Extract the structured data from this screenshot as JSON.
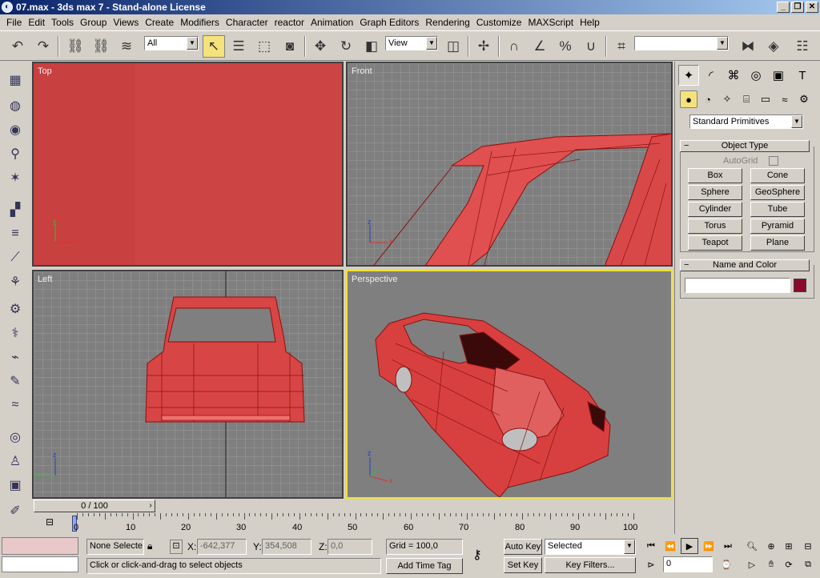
{
  "title": "07.max - 3ds max 7 - Stand-alone License",
  "window_buttons": [
    "_",
    "❐",
    "✕"
  ],
  "menu": [
    "File",
    "Edit",
    "Tools",
    "Group",
    "Views",
    "Create",
    "Modifiers",
    "Character",
    "reactor",
    "Animation",
    "Graph Editors",
    "Rendering",
    "Customize",
    "MAXScript",
    "Help"
  ],
  "toolbar": {
    "selection_filter": "All",
    "reference_coord": "View",
    "named_selection": ""
  },
  "viewports": {
    "top": "Top",
    "front": "Front",
    "left": "Left",
    "perspective": "Perspective"
  },
  "axes": {
    "x": "x",
    "y": "y",
    "z": "z"
  },
  "command_panel": {
    "dropdown": "Standard Primitives",
    "object_type_title": "Object Type",
    "autogrid": "AutoGrid",
    "primitives": [
      "Box",
      "Cone",
      "Sphere",
      "GeoSphere",
      "Cylinder",
      "Tube",
      "Torus",
      "Pyramid",
      "Teapot",
      "Plane"
    ],
    "name_color_title": "Name and Color",
    "name_value": "",
    "color": "#8b0a2c"
  },
  "time": {
    "slider": "0 / 100",
    "ticks": [
      "0",
      "10",
      "20",
      "30",
      "40",
      "50",
      "60",
      "70",
      "80",
      "90",
      "100"
    ]
  },
  "status": {
    "selection": "None Selecte",
    "x_label": "X:",
    "x_value": "-642,377",
    "y_label": "Y:",
    "y_value": "354,508",
    "z_label": "Z:",
    "z_value": "0,0",
    "grid": "Grid = 100,0",
    "prompt": "Click or click-and-drag to select objects",
    "add_time_tag": "Add Time Tag",
    "auto_key": "Auto Key",
    "set_key": "Set Key",
    "selected_dropdown": "Selected",
    "key_filters": "Key Filters...",
    "frame": "0"
  },
  "colors": {
    "top_viewport": "#c8403f",
    "mesh": "#e05050",
    "wire": "#8a1010",
    "active_border": "#f0e030"
  }
}
